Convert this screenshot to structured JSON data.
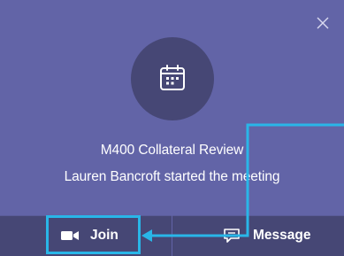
{
  "notification": {
    "title": "M400 Collateral Review",
    "subtitle": "Lauren Bancroft started the meeting",
    "icon": "calendar-icon"
  },
  "actions": {
    "join_label": "Join",
    "join_icon": "video-camera-icon",
    "message_label": "Message",
    "message_icon": "chat-icon"
  },
  "close_icon": "close-icon",
  "colors": {
    "toast_background": "#6264a7",
    "avatar_background": "#464775",
    "action_bar": "#464775",
    "annotation": "#29b6e8",
    "text": "#ffffff"
  }
}
